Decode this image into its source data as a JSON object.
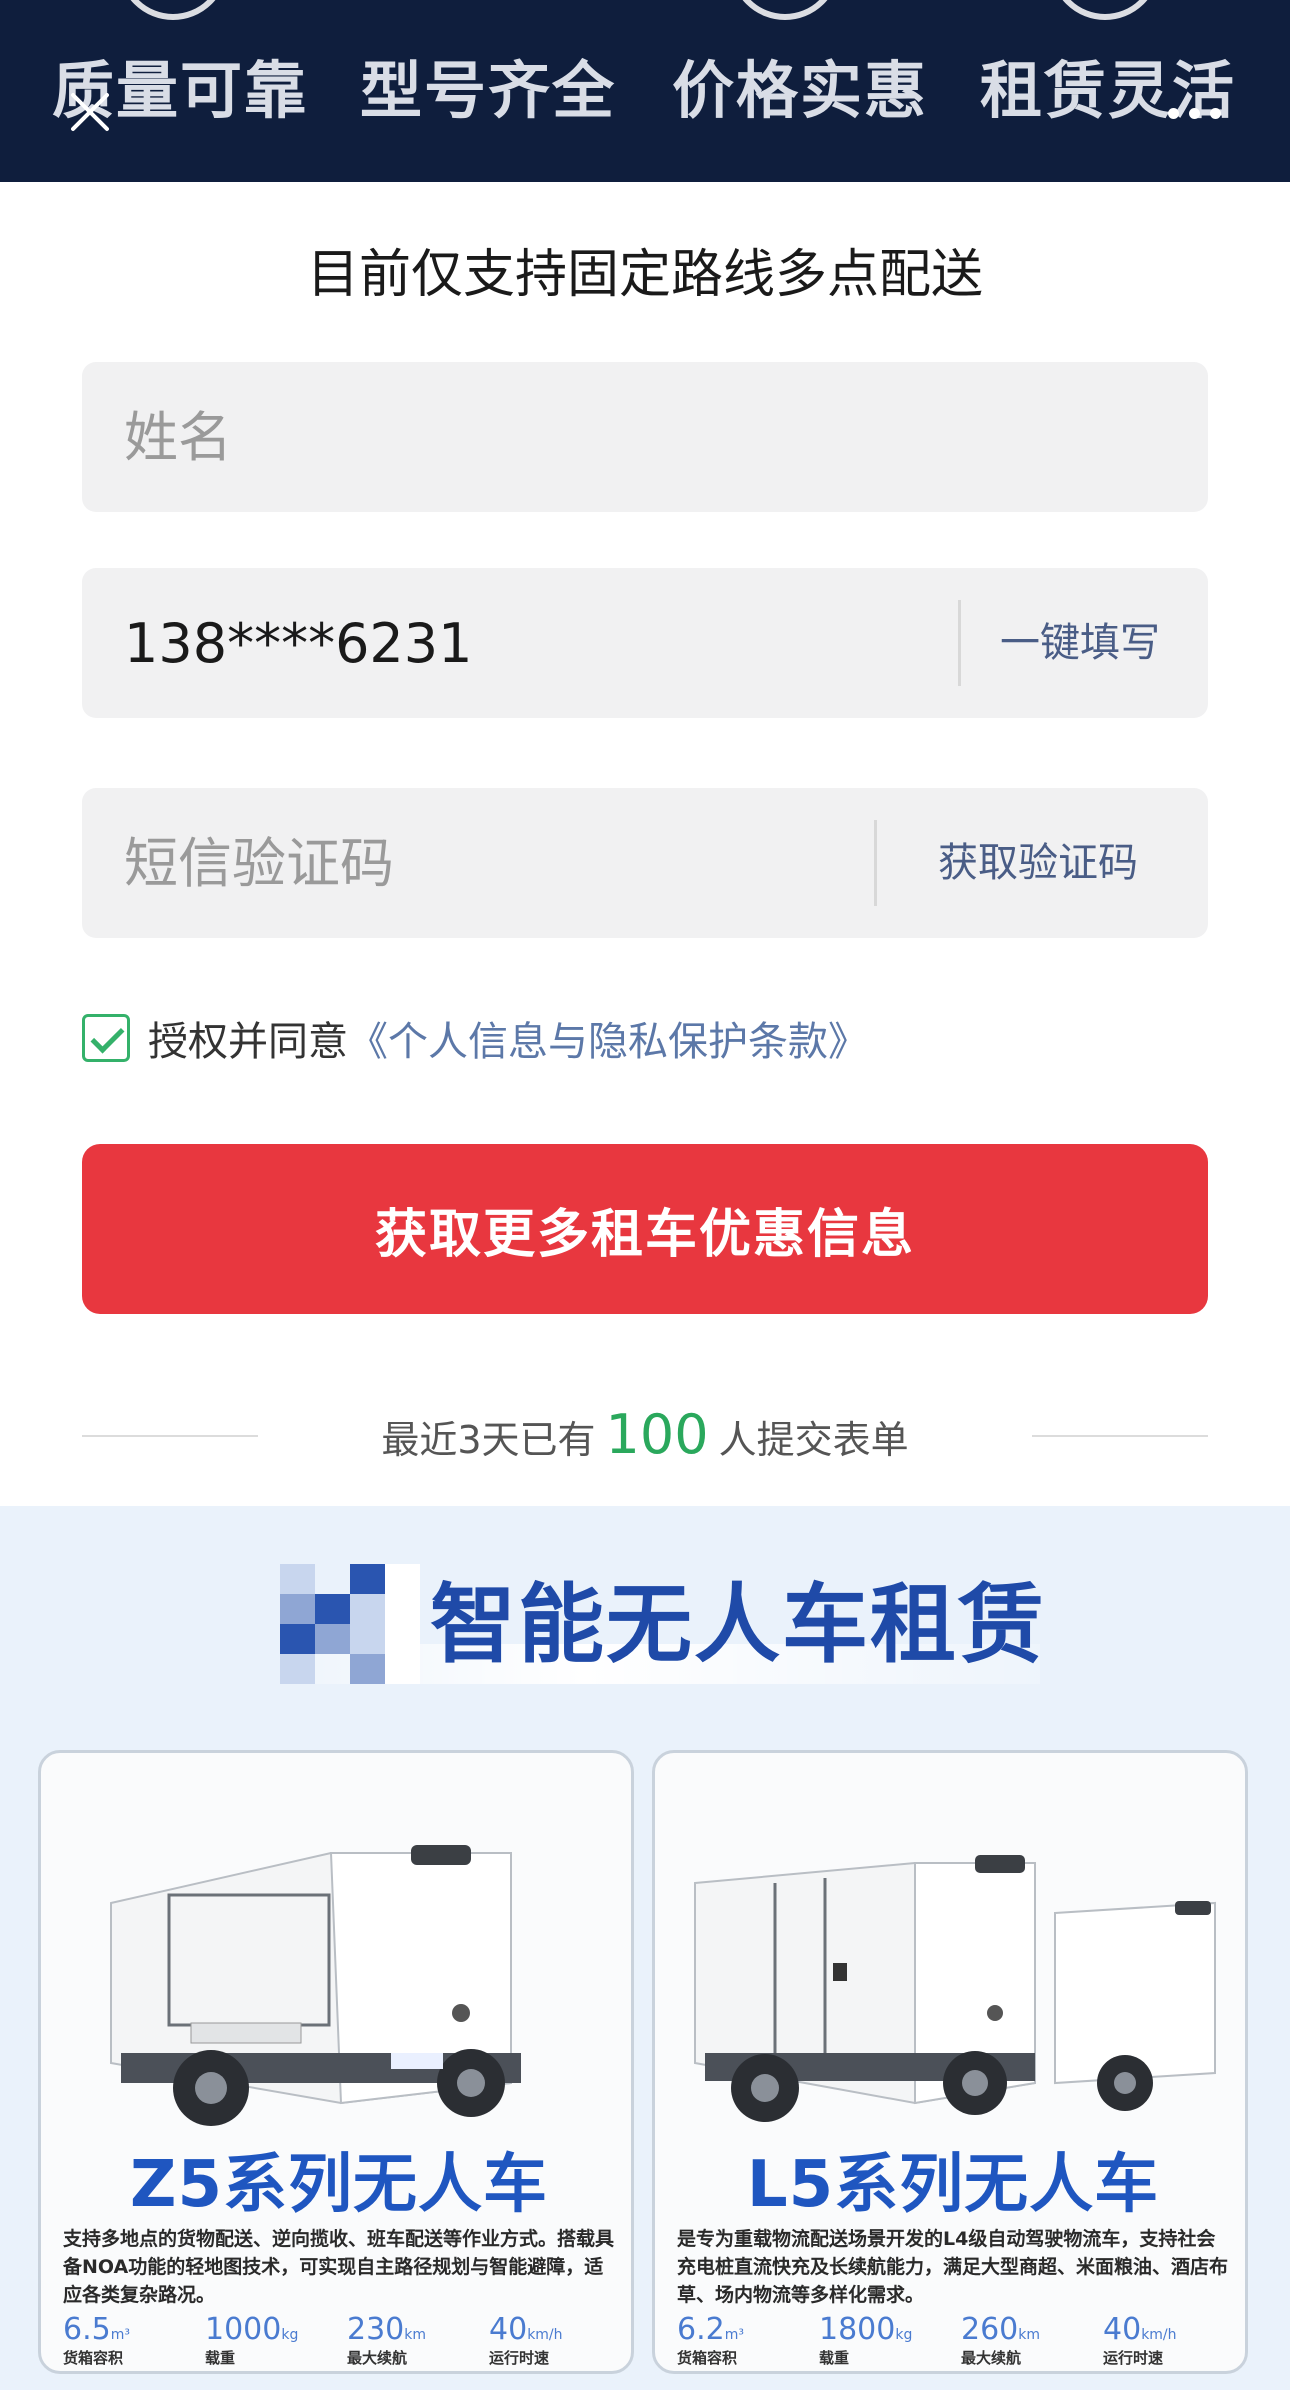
{
  "banner": {
    "taglines": [
      "质量可靠",
      "型号齐全",
      "价格实惠",
      "租赁灵活"
    ]
  },
  "form": {
    "subtitle": "目前仅支持固定路线多点配送",
    "name_placeholder": "姓名",
    "phone_value": "138****6231",
    "autofill_label": "一键填写",
    "sms_placeholder": "短信验证码",
    "get_code_label": "获取验证码",
    "agree_prefix": "授权并同意",
    "policy_link": "《个人信息与隐私保护条款》",
    "checkbox_checked": true,
    "submit_label": "获取更多租车优惠信息"
  },
  "stats": {
    "prefix": "最近3天已有",
    "count": "100",
    "suffix": "人提交表单"
  },
  "promo": {
    "title": "智能无人车租赁",
    "cards": [
      {
        "name": "Z5系列无人车",
        "description": "支持多地点的货物配送、逆向揽收、班车配送等作业方式。搭载具备NOA功能的轻地图技术，可实现自主路径规划与智能避障，适应各类复杂路况。",
        "specs": [
          {
            "value": "6.5",
            "unit": "m³",
            "label": "货箱容积"
          },
          {
            "value": "1000",
            "unit": "kg",
            "label": "载重"
          },
          {
            "value": "230",
            "unit": "km",
            "label": "最大续航"
          },
          {
            "value": "40",
            "unit": "km/h",
            "label": "运行时速"
          }
        ]
      },
      {
        "name": "L5系列无人车",
        "description": "是专为重载物流配送场景开发的L4级自动驾驶物流车，支持社会充电桩直流快充及长续航能力，满足大型商超、米面粮油、酒店布草、场内物流等多样化需求。",
        "specs": [
          {
            "value": "6.2",
            "unit": "m³",
            "label": "货箱容积"
          },
          {
            "value": "1800",
            "unit": "kg",
            "label": "载重"
          },
          {
            "value": "260",
            "unit": "km",
            "label": "最大续航"
          },
          {
            "value": "40",
            "unit": "km/h",
            "label": "运行时速"
          }
        ]
      }
    ]
  },
  "colors": {
    "banner_bg": "#0f1e3d",
    "primary_red": "#e8373f",
    "success_green": "#34b16a",
    "link_blue": "#5c78a8",
    "promo_blue": "#1f4aa8"
  },
  "icons": {
    "close": "close-icon",
    "more": "more-dots-icon",
    "checkbox": "checkmark-icon"
  }
}
